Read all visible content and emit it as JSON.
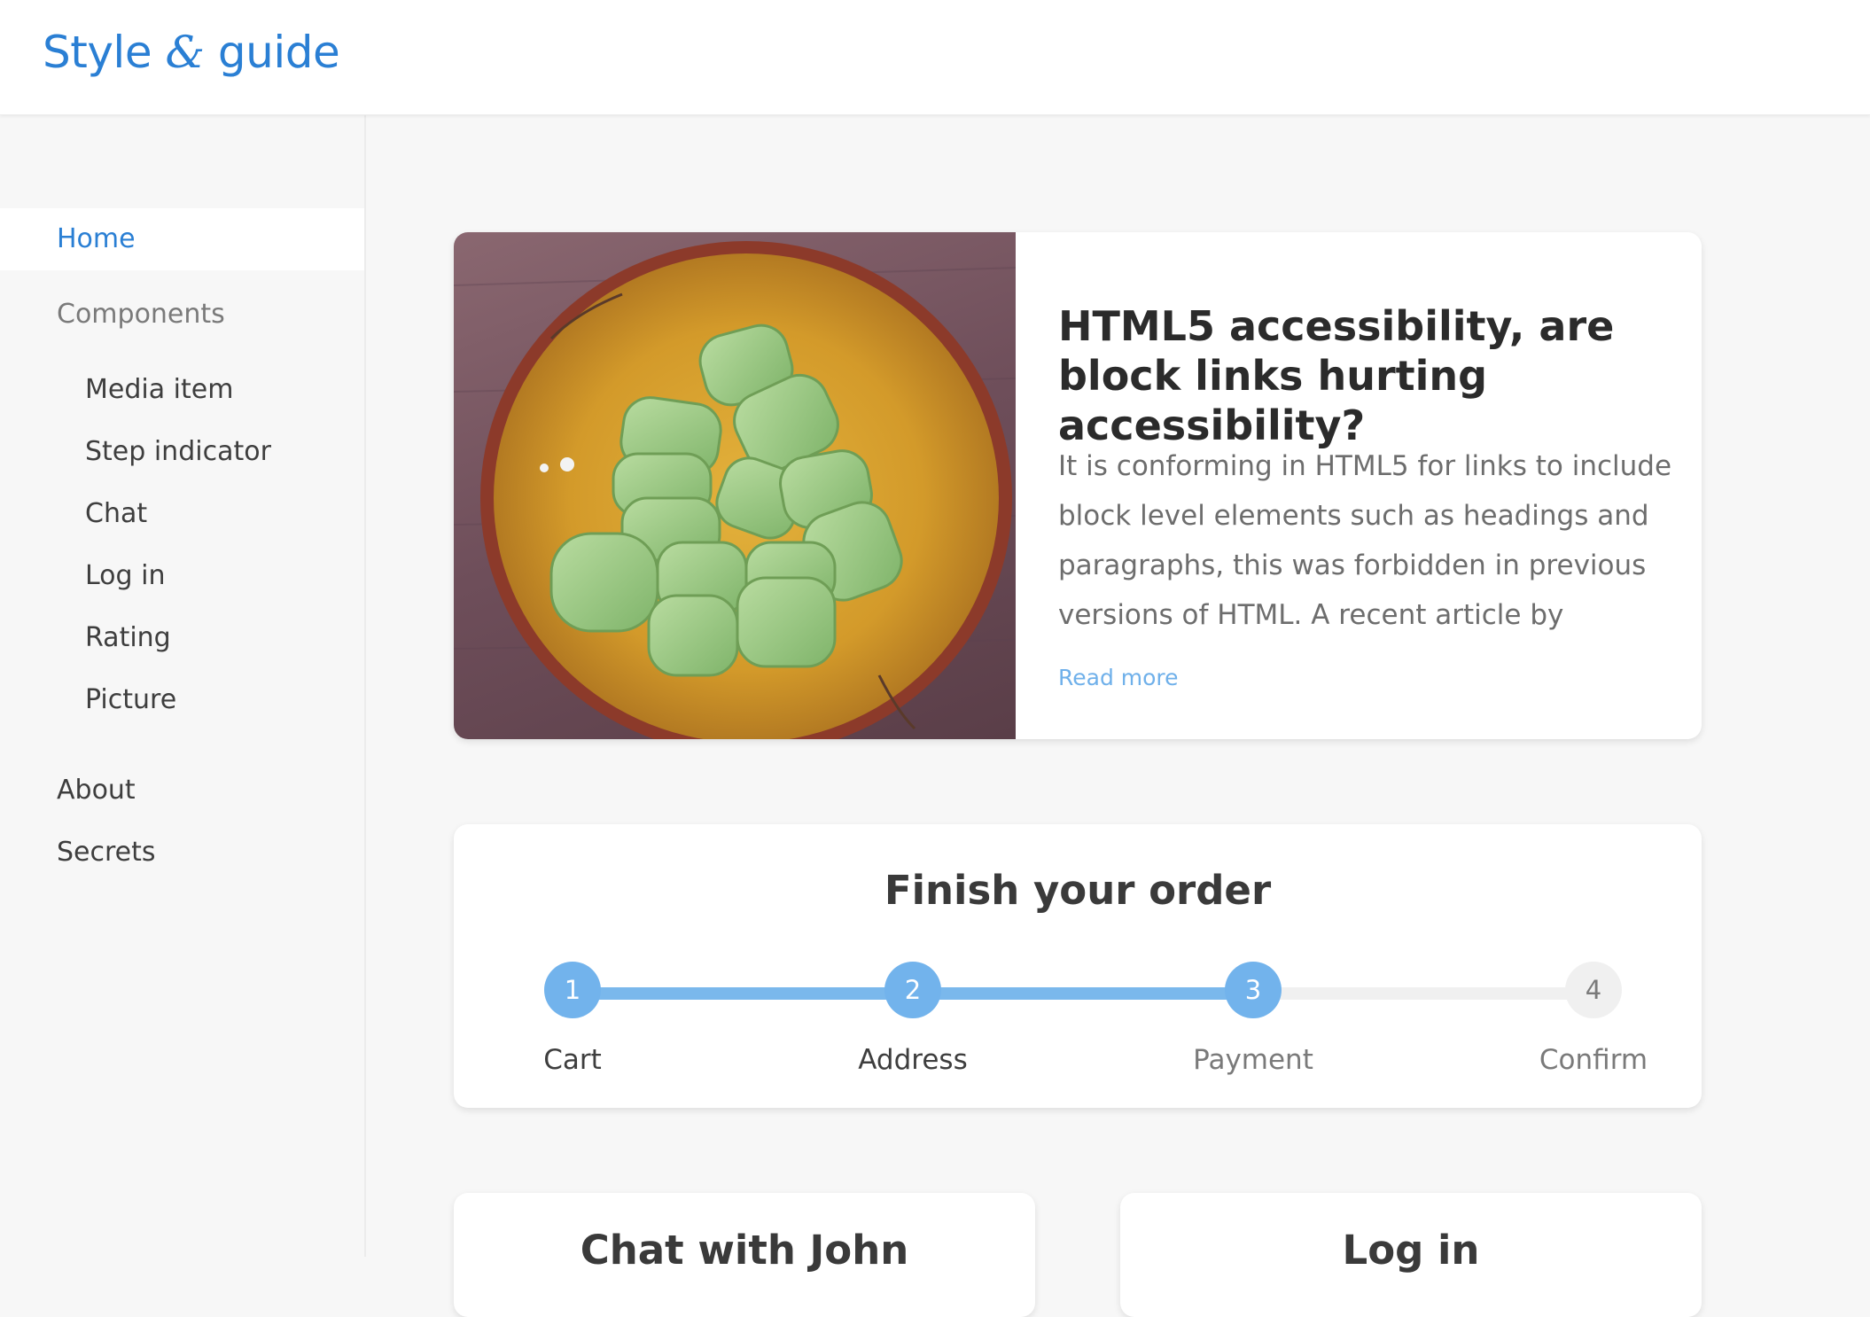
{
  "header": {
    "logo_part1": "Style ",
    "logo_amp": "&",
    "logo_part2": " guide",
    "brand_color": "#2a7fd4"
  },
  "sidebar": {
    "items": [
      {
        "label": "Home",
        "state": "active"
      },
      {
        "label": "Components",
        "state": "group"
      },
      {
        "label": "Media item",
        "state": "sub"
      },
      {
        "label": "Step indicator",
        "state": "sub"
      },
      {
        "label": "Chat",
        "state": "sub"
      },
      {
        "label": "Log in",
        "state": "sub"
      },
      {
        "label": "Rating",
        "state": "sub"
      },
      {
        "label": "Picture",
        "state": "sub"
      },
      {
        "label": "About",
        "state": "normal"
      },
      {
        "label": "Secrets",
        "state": "normal"
      }
    ]
  },
  "media_item": {
    "image_alt": "bowl of cucumber pieces",
    "title": "HTML5 accessibility, are block links hurting accessibility?",
    "body": "It is conforming in HTML5 for links to include block level elements such as headings and paragraphs, this was forbidden in previous versions of HTML. A recent article by @feathe…",
    "read_more": "Read more"
  },
  "step_indicator": {
    "title": "Finish your order",
    "steps": [
      {
        "number": "1",
        "label": "Cart",
        "done": true
      },
      {
        "number": "2",
        "label": "Address",
        "done": true
      },
      {
        "number": "3",
        "label": "Payment",
        "done": true
      },
      {
        "number": "4",
        "label": "Confirm",
        "done": false
      }
    ],
    "done_color": "#72b3ec",
    "todo_color": "#f0f0f0"
  },
  "chat_card": {
    "title": "Chat with John"
  },
  "login_card": {
    "title": "Log in"
  }
}
